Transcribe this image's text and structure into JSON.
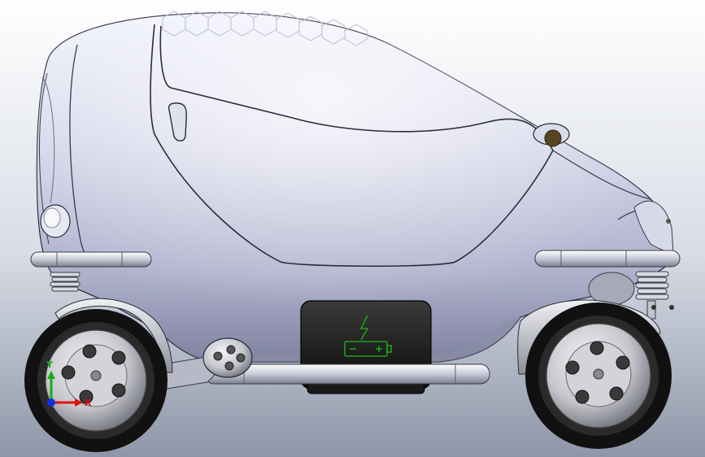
{
  "viewport": {
    "background_top": "#ffffff",
    "background_bottom": "#8e96a8"
  },
  "model": {
    "body_color": "#c9cbe0",
    "body_shadow": "#8d90ad",
    "trim_color": "#d9dbe6",
    "tire_color": "#111111",
    "battery_box_color": "#1b1b1b",
    "battery_icon_color": "#1aa31a",
    "headlight_color": "#5a4522"
  },
  "triad": {
    "x_color": "#e01010",
    "y_color": "#10b010",
    "z_color": "#1030e0",
    "y_label": "Y",
    "x_label": "X"
  },
  "icons": {
    "battery": "battery-charging-icon"
  }
}
